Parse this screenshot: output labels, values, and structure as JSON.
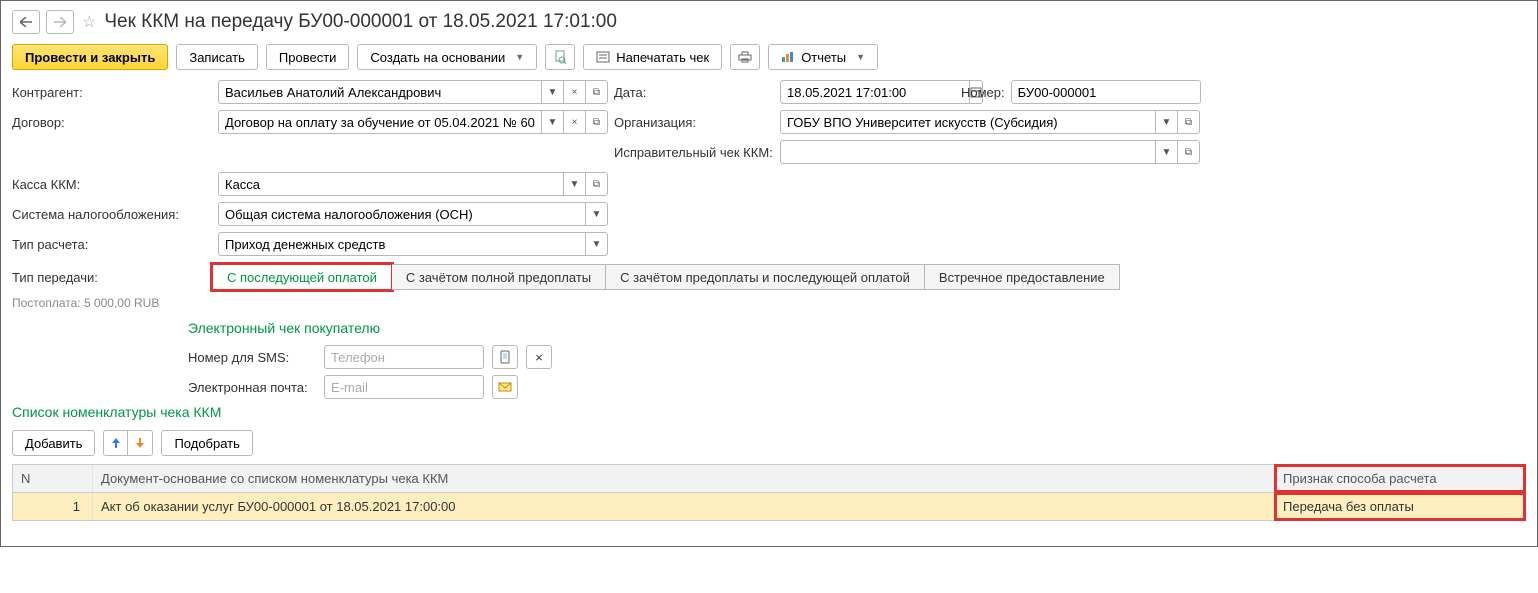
{
  "title": "Чек ККМ на передачу БУ00-000001 от 18.05.2021 17:01:00",
  "toolbar": {
    "conduct_close": "Провести и закрыть",
    "save": "Записать",
    "conduct": "Провести",
    "create_based": "Создать на основании",
    "print_check": "Напечатать чек",
    "reports": "Отчеты"
  },
  "fields": {
    "counterparty_lbl": "Контрагент:",
    "counterparty": "Васильев Анатолий Александрович",
    "date_lbl": "Дата:",
    "date": "18.05.2021 17:01:00",
    "number_lbl": "Номер:",
    "number": "БУ00-000001",
    "contract_lbl": "Договор:",
    "contract": "Договор на оплату за обучение от 05.04.2021 № 60",
    "org_lbl": "Организация:",
    "org": "ГОБУ ВПО Университет искусств (Субсидия)",
    "corr_lbl": "Исправительный чек ККМ:",
    "corr": "",
    "kassa_lbl": "Касса ККМ:",
    "kassa": "Касса",
    "tax_lbl": "Система налогообложения:",
    "tax": "Общая система налогообложения (ОСН)",
    "calc_type_lbl": "Тип расчета:",
    "calc_type": "Приход денежных средств",
    "transfer_lbl": "Тип передачи:"
  },
  "transfer_options": [
    "С последующей оплатой",
    "С зачётом полной предоплаты",
    "С зачётом предоплаты и последующей оплатой",
    "Встречное предоставление"
  ],
  "postpay": "Постоплата: 5 000,00 RUB",
  "echeck": {
    "title": "Электронный чек покупателю",
    "sms_lbl": "Номер для SMS:",
    "sms_ph": "Телефон",
    "email_lbl": "Электронная почта:",
    "email_ph": "E-mail"
  },
  "list": {
    "title": "Список номенклатуры чека ККМ",
    "add": "Добавить",
    "pick": "Подобрать",
    "cols": {
      "n": "N",
      "doc": "Документ-основание со списком номенклатуры чека ККМ",
      "sign": "Признак способа расчета"
    },
    "rows": [
      {
        "n": "1",
        "doc": "Акт об оказании услуг БУ00-000001 от 18.05.2021 17:00:00",
        "sign": "Передача без оплаты"
      }
    ]
  }
}
